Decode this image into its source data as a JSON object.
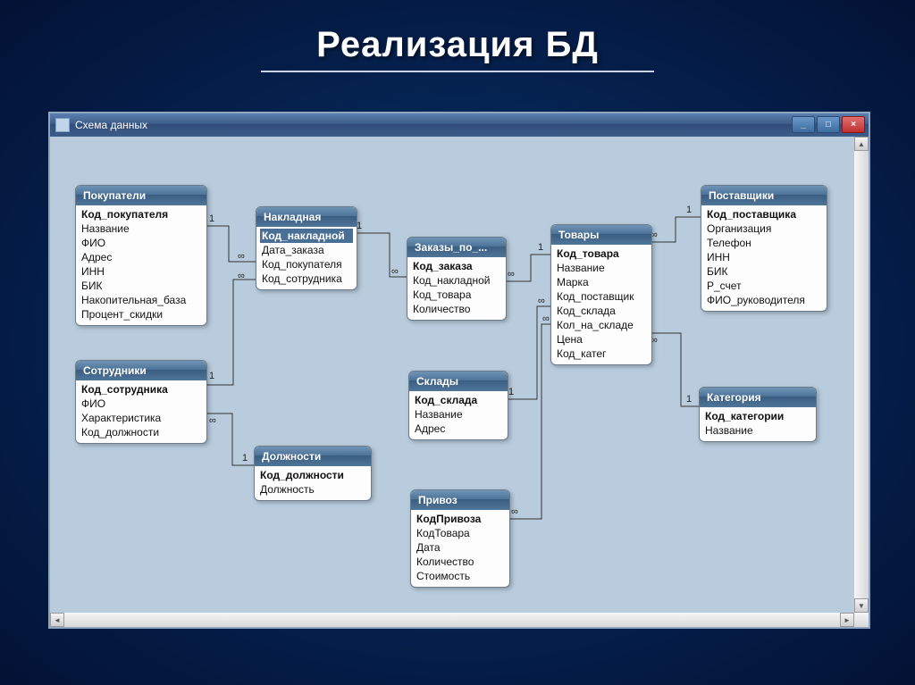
{
  "slide_title": "Реализация БД",
  "window": {
    "title": "Схема данных",
    "btn_min": "_",
    "btn_max": "□",
    "btn_close": "×"
  },
  "tables": {
    "pokupateli": {
      "title": "Покупатели",
      "fields": [
        "Код_покупателя",
        "Название",
        "ФИО",
        "Адрес",
        "ИНН",
        "БИК",
        "Накопительная_база",
        "Процент_скидки"
      ],
      "pk": 0
    },
    "sotrudniki": {
      "title": "Сотрудники",
      "fields": [
        "Код_сотрудника",
        "ФИО",
        "Характеристика",
        "Код_должности"
      ],
      "pk": 0
    },
    "nakladnaya": {
      "title": "Накладная",
      "fields": [
        "Код_накладной",
        "Дата_заказа",
        "Код_покупателя",
        "Код_сотрудника"
      ],
      "pk": 0,
      "selected": 0
    },
    "dolzhnosti": {
      "title": "Должности",
      "fields": [
        "Код_должности",
        "Должность"
      ],
      "pk": 0
    },
    "zakazy": {
      "title": "Заказы_по_...",
      "fields": [
        "Код_заказа",
        "Код_накладной",
        "Код_товара",
        "Количество"
      ],
      "pk": 0
    },
    "sklady": {
      "title": "Склады",
      "fields": [
        "Код_склада",
        "Название",
        "Адрес"
      ],
      "pk": 0
    },
    "privoz": {
      "title": "Привоз",
      "fields": [
        "КодПривоза",
        "КодТовара",
        "Дата",
        "Количество",
        "Стоимость"
      ],
      "pk": 0
    },
    "tovary": {
      "title": "Товары",
      "fields": [
        "Код_товара",
        "Название",
        "Марка",
        "Код_поставщик",
        "Код_склада",
        "Кол_на_складе",
        "Цена",
        "Код_катег"
      ],
      "pk": 0
    },
    "postavshiki": {
      "title": "Поставщики",
      "fields": [
        "Код_поставщика",
        "Организация",
        "Телефон",
        "ИНН",
        "БИК",
        "Р_счет",
        "ФИО_руководителя"
      ],
      "pk": 0
    },
    "kategoriya": {
      "title": "Категория",
      "fields": [
        "Код_категории",
        "Название"
      ],
      "pk": 0
    }
  },
  "cardinality": {
    "one": "1",
    "many": "∞"
  }
}
